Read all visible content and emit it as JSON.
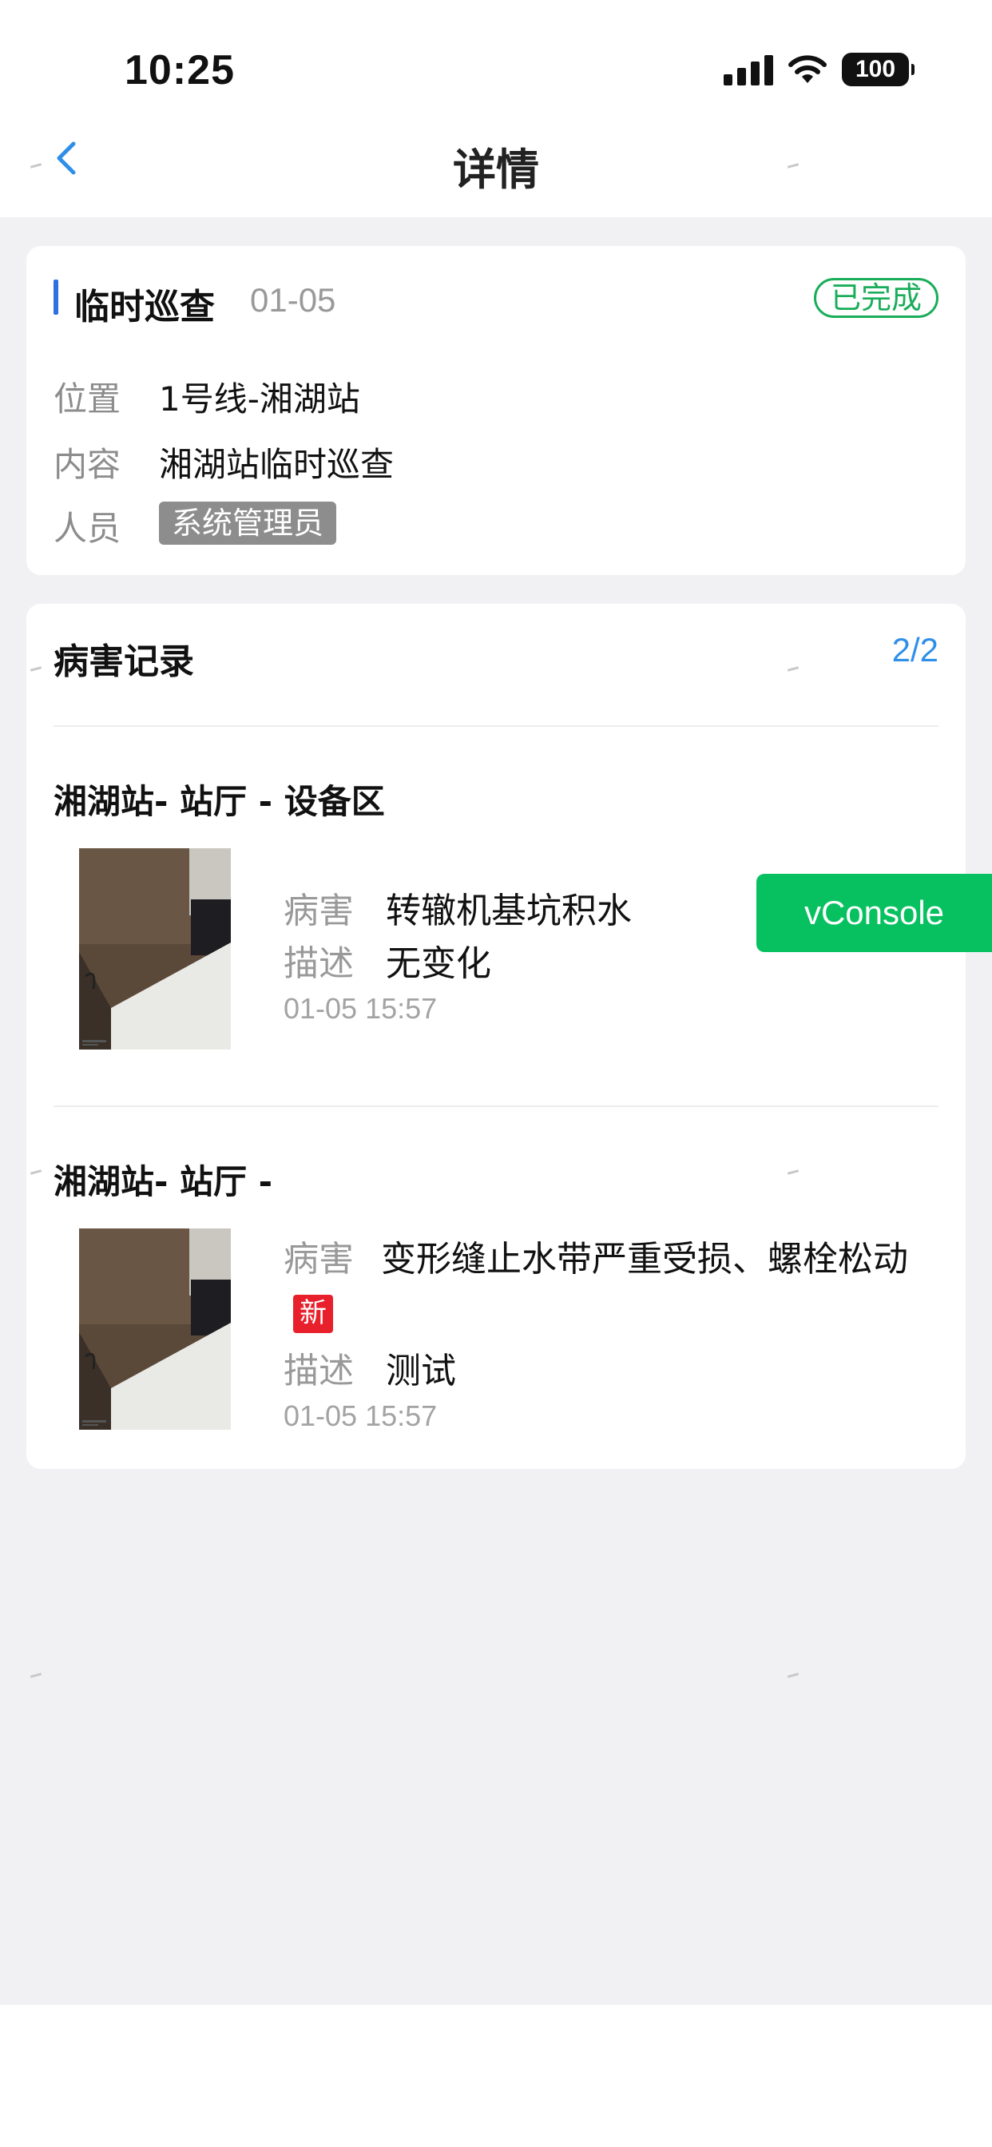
{
  "status_bar": {
    "time": "10:25",
    "battery": "100"
  },
  "header": {
    "title": "详情",
    "back_icon": "chevron-left-icon"
  },
  "summary": {
    "title": "临时巡查",
    "date": "01-05",
    "status": "已完成",
    "location_label": "位置",
    "location_value": "1号线-湘湖站",
    "content_label": "内容",
    "content_value": "湘湖站临时巡查",
    "person_label": "人员",
    "person_value": "系统管理员"
  },
  "records": {
    "title": "病害记录",
    "count": "2/2",
    "items": [
      {
        "title": "湘湖站- 站厅 - 设备区",
        "disease_label": "病害",
        "disease_value": "转辙机基坑积水",
        "desc_label": "描述",
        "desc_value": "无变化",
        "time": "01-05 15:57"
      },
      {
        "title": "湘湖站- 站厅 -",
        "disease_label": "病害",
        "disease_value": "变形缝止水带严重受损、螺栓松动",
        "new_badge": "新",
        "desc_label": "描述",
        "desc_value": "测试",
        "time": "01-05 15:57"
      }
    ]
  },
  "vconsole": {
    "label": "vConsole"
  },
  "colors": {
    "accent": "#2f6fde",
    "success": "#1aad5a",
    "link": "#2f8fe8",
    "new_badge": "#e8202c",
    "vconsole": "#07c160"
  }
}
